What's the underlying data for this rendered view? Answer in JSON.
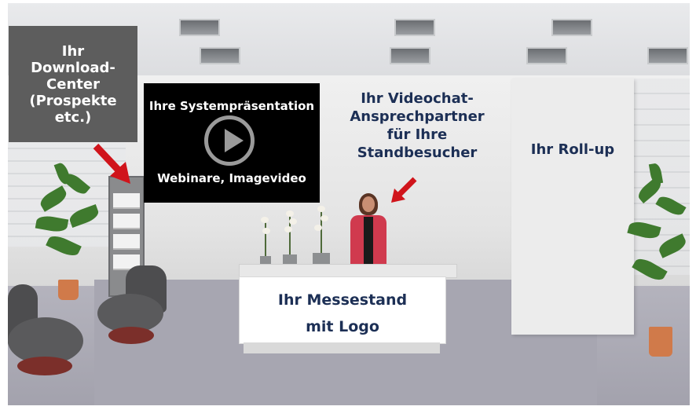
{
  "labels": {
    "download_center": [
      "Ihr",
      "Download-",
      "Center",
      "(Prospekte",
      "etc.)"
    ],
    "video_title": "Ihre Systempräsentation",
    "video_subtitle": "Webinare, Imagevideo",
    "videochat": [
      "Ihr Videochat-",
      "Ansprechpartner",
      "für Ihre",
      "Standbesucher"
    ],
    "rollup": "Ihr Roll-up",
    "desk": [
      "Ihr Messestand",
      "mit Logo"
    ]
  },
  "icons": {
    "play": "play-circle-icon",
    "arrow": "red-arrow-icon"
  },
  "colors": {
    "label_navy": "#1c2f55",
    "arrow_red": "#d0141b",
    "download_panel": "#5d5d5d",
    "video_screen": "#000000"
  }
}
